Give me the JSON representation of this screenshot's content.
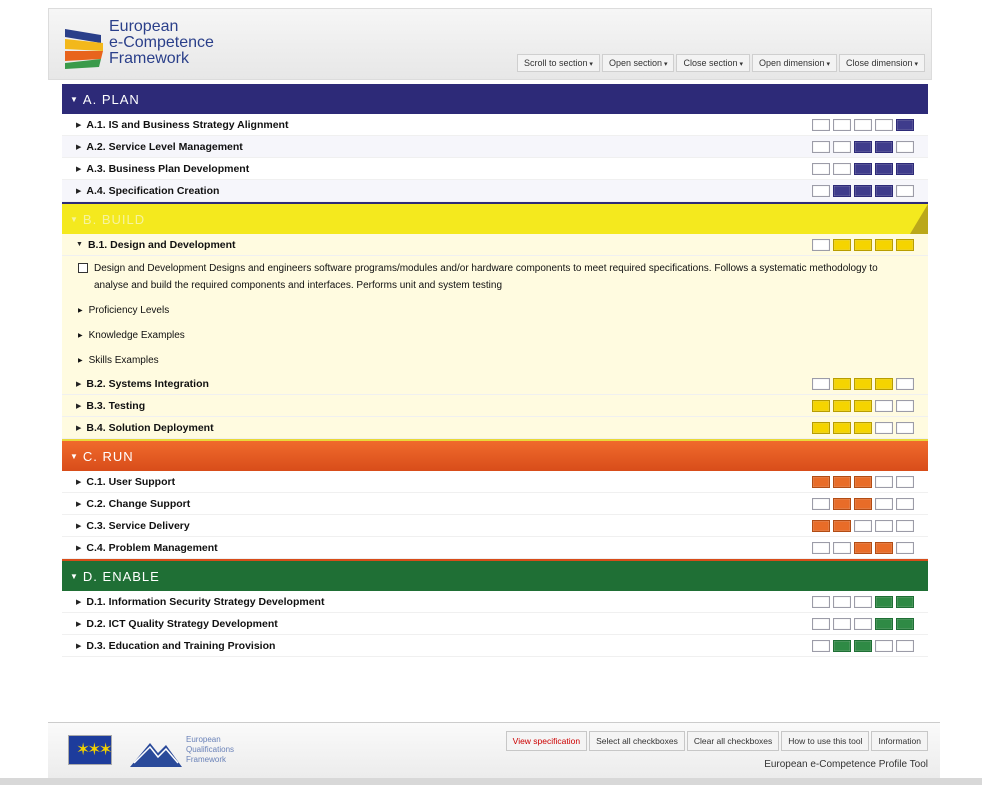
{
  "logo": {
    "line1": "European",
    "line2": "e-Competence",
    "line3": "Framework"
  },
  "toolbar": [
    "Scroll to section",
    "Open section",
    "Close section",
    "Open dimension",
    "Close dimension"
  ],
  "colors": {
    "plan": "#2d2a78",
    "build": "#f4e91e",
    "run": "#e0561f",
    "enable": "#1f6f35"
  },
  "sections": [
    {
      "key": "plan",
      "title": "A. PLAN",
      "items": [
        {
          "label": "A.1. IS and Business Strategy Alignment",
          "levels": [
            0,
            0,
            0,
            0,
            1
          ]
        },
        {
          "label": "A.2. Service Level Management",
          "levels": [
            0,
            0,
            1,
            1,
            0
          ]
        },
        {
          "label": "A.3. Business Plan Development",
          "levels": [
            0,
            0,
            1,
            1,
            1
          ]
        },
        {
          "label": "A.4. Specification Creation",
          "levels": [
            0,
            1,
            1,
            1,
            0
          ]
        }
      ]
    },
    {
      "key": "build",
      "title": "B. BUILD",
      "items": [
        {
          "label": "B.1. Design and Development",
          "levels": [
            0,
            1,
            1,
            1,
            1
          ],
          "expanded": true,
          "description": "Design and Development Designs and engineers software programs/modules and/or hardware components to meet required specifications. Follows a systematic methodology to analyse and build the required components and interfaces. Performs unit and system testing",
          "subs": [
            "Proficiency Levels",
            "Knowledge Examples",
            "Skills Examples"
          ]
        },
        {
          "label": "B.2. Systems Integration",
          "levels": [
            0,
            1,
            1,
            1,
            0
          ]
        },
        {
          "label": "B.3. Testing",
          "levels": [
            1,
            1,
            1,
            0,
            0
          ]
        },
        {
          "label": "B.4. Solution Deployment",
          "levels": [
            1,
            1,
            1,
            0,
            0
          ]
        }
      ]
    },
    {
      "key": "run",
      "title": "C. RUN",
      "items": [
        {
          "label": "C.1. User Support",
          "levels": [
            1,
            1,
            1,
            0,
            0
          ]
        },
        {
          "label": "C.2. Change Support",
          "levels": [
            0,
            1,
            1,
            0,
            0
          ]
        },
        {
          "label": "C.3. Service Delivery",
          "levels": [
            1,
            1,
            0,
            0,
            0
          ]
        },
        {
          "label": "C.4. Problem Management",
          "levels": [
            0,
            0,
            1,
            1,
            0
          ]
        }
      ]
    },
    {
      "key": "enable",
      "title": "D. ENABLE",
      "items": [
        {
          "label": "D.1. Information Security Strategy Development",
          "levels": [
            0,
            0,
            0,
            1,
            1
          ]
        },
        {
          "label": "D.2. ICT Quality Strategy Development",
          "levels": [
            0,
            0,
            0,
            1,
            1
          ]
        },
        {
          "label": "D.3. Education and Training Provision",
          "levels": [
            0,
            1,
            1,
            0,
            0
          ]
        }
      ]
    }
  ],
  "footer": {
    "eqf": {
      "line1": "European",
      "line2": "Qualifications",
      "line3": "Framework"
    },
    "buttons": [
      "View specification",
      "Select all checkboxes",
      "Clear all checkboxes",
      "How to use this tool",
      "Information"
    ],
    "title": "European e-Competence Profile Tool"
  }
}
